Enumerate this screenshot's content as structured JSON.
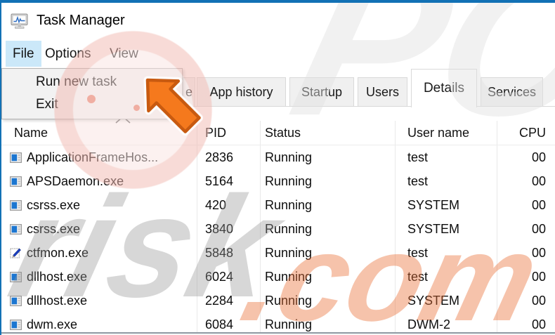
{
  "window": {
    "title": "Task Manager"
  },
  "colors": {
    "accent_border": "#1271b5",
    "menu_highlight": "#cbe8f9",
    "arrow_fill": "#f5791d",
    "arrow_outline": "#c85a10",
    "tab_inactive_bg": "#f0f0f0",
    "tab_active_bg": "#ffffff",
    "dropdown_bg": "#f2f2f2"
  },
  "menu_bar": {
    "highlighted": "File",
    "items": [
      {
        "label": "File"
      },
      {
        "label": "Options"
      },
      {
        "label": "View"
      }
    ]
  },
  "file_menu": {
    "items": [
      {
        "label": "Run new task"
      },
      {
        "label": "Exit"
      }
    ]
  },
  "tabs": {
    "active": "Details",
    "items": [
      {
        "label": "e"
      },
      {
        "label": "App history"
      },
      {
        "label": "Startup"
      },
      {
        "label": "Users"
      },
      {
        "label": "Details"
      },
      {
        "label": "Services"
      }
    ]
  },
  "table": {
    "sort": {
      "column": "Name",
      "direction": "ascending"
    },
    "columns": [
      {
        "label": "Name"
      },
      {
        "label": "PID"
      },
      {
        "label": "Status"
      },
      {
        "label": "User name"
      },
      {
        "label": "CPU"
      }
    ],
    "rows": [
      {
        "name": "ApplicationFrameHos...",
        "pid": "2836",
        "status": "Running",
        "user": "test",
        "cpu": "00",
        "icon": "window-icon"
      },
      {
        "name": "APSDaemon.exe",
        "pid": "5164",
        "status": "Running",
        "user": "test",
        "cpu": "00",
        "icon": "window-icon"
      },
      {
        "name": "csrss.exe",
        "pid": "420",
        "status": "Running",
        "user": "SYSTEM",
        "cpu": "00",
        "icon": "window-icon"
      },
      {
        "name": "csrss.exe",
        "pid": "3840",
        "status": "Running",
        "user": "SYSTEM",
        "cpu": "00",
        "icon": "window-icon"
      },
      {
        "name": "ctfmon.exe",
        "pid": "5848",
        "status": "Running",
        "user": "test",
        "cpu": "00",
        "icon": "pen-icon"
      },
      {
        "name": "dllhost.exe",
        "pid": "6024",
        "status": "Running",
        "user": "test",
        "cpu": "00",
        "icon": "window-icon"
      },
      {
        "name": "dllhost.exe",
        "pid": "2284",
        "status": "Running",
        "user": "SYSTEM",
        "cpu": "00",
        "icon": "window-icon"
      },
      {
        "name": "dwm.exe",
        "pid": "6084",
        "status": "Running",
        "user": "DWM-2",
        "cpu": "00",
        "icon": "window-icon"
      }
    ]
  },
  "watermark": {
    "pc": "PC",
    "risk": "risk",
    "dotcom": ".com"
  }
}
